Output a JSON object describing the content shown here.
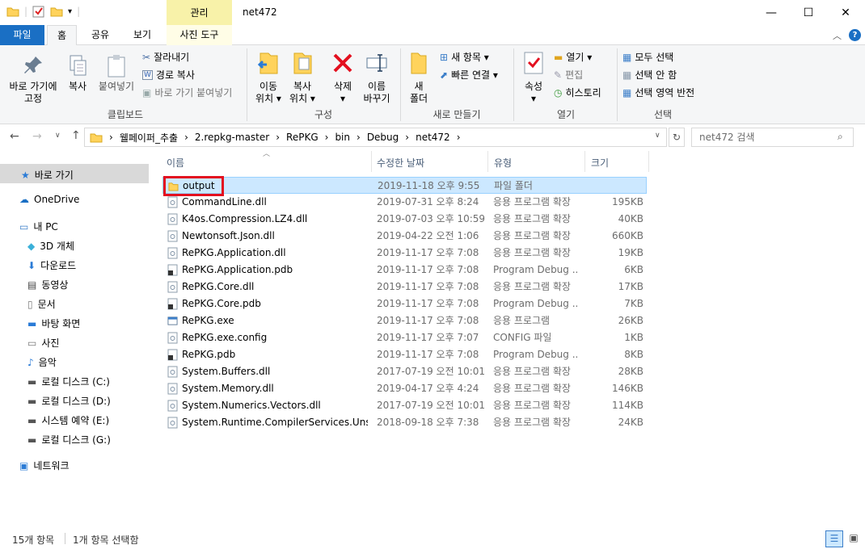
{
  "window": {
    "context_tab": "관리",
    "title": "net472",
    "minimize_glyph": "—",
    "maximize_glyph": "☐",
    "close_glyph": "✕"
  },
  "tabs": {
    "file": "파일",
    "home": "홈",
    "share": "공유",
    "view": "보기",
    "picture_tools": "사진 도구"
  },
  "ribbon": {
    "pin_label_1": "바로 가기에",
    "pin_label_2": "고정",
    "copy": "복사",
    "paste": "붙여넣기",
    "cut": "잘라내기",
    "copy_path": "경로 복사",
    "paste_shortcut": "바로 가기 붙여넣기",
    "group_clipboard": "클립보드",
    "move_to_1": "이동",
    "move_to_2": "위치 ▾",
    "copy_to_1": "복사",
    "copy_to_2": "위치 ▾",
    "delete": "삭제",
    "delete_arrow": "▾",
    "rename_1": "이름",
    "rename_2": "바꾸기",
    "group_organize": "구성",
    "new_folder_1": "새",
    "new_folder_2": "폴더",
    "new_item": "새 항목 ▾",
    "easy_access": "빠른 연결 ▾",
    "group_new": "새로 만들기",
    "properties": "속성",
    "properties_arrow": "▾",
    "open": "열기 ▾",
    "edit": "편집",
    "history": "히스토리",
    "group_open": "열기",
    "select_all": "모두 선택",
    "select_none": "선택 안 함",
    "invert_selection": "선택 영역 반전",
    "group_select": "선택"
  },
  "address": {
    "crumbs": [
      "웰페이퍼_추출",
      "2.repkg-master",
      "RePKG",
      "bin",
      "Debug",
      "net472"
    ],
    "separator": "›",
    "search_placeholder": "net472 검색"
  },
  "nav": {
    "quick_access": "바로 가기",
    "onedrive": "OneDrive",
    "this_pc": "내 PC",
    "objects_3d": "3D 개체",
    "downloads": "다운로드",
    "videos": "동영상",
    "documents": "문서",
    "desktop": "바탕 화면",
    "pictures": "사진",
    "music": "음악",
    "drive_c": "로컬 디스크 (C:)",
    "drive_d": "로컬 디스크 (D:)",
    "drive_e": "시스템 예약 (E:)",
    "drive_g": "로컬 디스크 (G:)",
    "network": "네트워크"
  },
  "columns": {
    "name": "이름",
    "date": "수정한 날짜",
    "type": "유형",
    "size": "크기"
  },
  "files": [
    {
      "name": "output",
      "date": "2019-11-18 오후 9:55",
      "type": "파일 폴더",
      "size": "",
      "icon": "folder-icon"
    },
    {
      "name": "CommandLine.dll",
      "date": "2019-07-31 오후 8:24",
      "type": "응용 프로그램 확장",
      "size": "195KB",
      "icon": "dll-icon"
    },
    {
      "name": "K4os.Compression.LZ4.dll",
      "date": "2019-07-03 오후 10:59",
      "type": "응용 프로그램 확장",
      "size": "40KB",
      "icon": "dll-icon"
    },
    {
      "name": "Newtonsoft.Json.dll",
      "date": "2019-04-22 오전 1:06",
      "type": "응용 프로그램 확장",
      "size": "660KB",
      "icon": "dll-icon"
    },
    {
      "name": "RePKG.Application.dll",
      "date": "2019-11-17 오후 7:08",
      "type": "응용 프로그램 확장",
      "size": "19KB",
      "icon": "dll-icon"
    },
    {
      "name": "RePKG.Application.pdb",
      "date": "2019-11-17 오후 7:08",
      "type": "Program Debug ...",
      "size": "6KB",
      "icon": "pdb-icon"
    },
    {
      "name": "RePKG.Core.dll",
      "date": "2019-11-17 오후 7:08",
      "type": "응용 프로그램 확장",
      "size": "17KB",
      "icon": "dll-icon"
    },
    {
      "name": "RePKG.Core.pdb",
      "date": "2019-11-17 오후 7:08",
      "type": "Program Debug ...",
      "size": "7KB",
      "icon": "pdb-icon"
    },
    {
      "name": "RePKG.exe",
      "date": "2019-11-17 오후 7:08",
      "type": "응용 프로그램",
      "size": "26KB",
      "icon": "exe-icon"
    },
    {
      "name": "RePKG.exe.config",
      "date": "2019-11-17 오후 7:07",
      "type": "CONFIG 파일",
      "size": "1KB",
      "icon": "config-icon"
    },
    {
      "name": "RePKG.pdb",
      "date": "2019-11-17 오후 7:08",
      "type": "Program Debug ...",
      "size": "8KB",
      "icon": "pdb-icon"
    },
    {
      "name": "System.Buffers.dll",
      "date": "2017-07-19 오전 10:01",
      "type": "응용 프로그램 확장",
      "size": "28KB",
      "icon": "dll-icon"
    },
    {
      "name": "System.Memory.dll",
      "date": "2019-04-17 오후 4:24",
      "type": "응용 프로그램 확장",
      "size": "146KB",
      "icon": "dll-icon"
    },
    {
      "name": "System.Numerics.Vectors.dll",
      "date": "2017-07-19 오전 10:01",
      "type": "응용 프로그램 확장",
      "size": "114KB",
      "icon": "dll-icon"
    },
    {
      "name": "System.Runtime.CompilerServices.Unsaf...",
      "date": "2018-09-18 오후 7:38",
      "type": "응용 프로그램 확장",
      "size": "24KB",
      "icon": "dll-icon"
    }
  ],
  "status": {
    "count": "15개 항목",
    "selected": "1개 항목 선택함"
  },
  "colors": {
    "file_tab": "#1a6fc4",
    "context_tab": "#f8f2a9",
    "selection": "#cce8ff",
    "highlight_box": "#e3101f"
  }
}
